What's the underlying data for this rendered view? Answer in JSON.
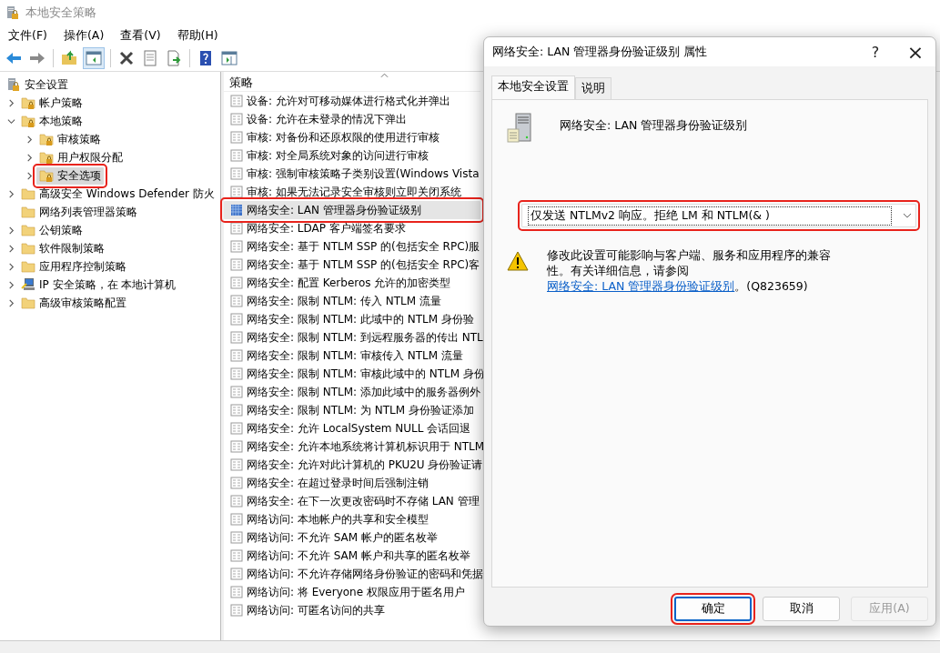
{
  "window": {
    "title": "本地安全策略"
  },
  "menu": [
    "文件(F)",
    "操作(A)",
    "查看(V)",
    "帮助(H)"
  ],
  "tree": [
    {
      "label": "安全设置",
      "kind": "root",
      "selected": false,
      "annotated": false,
      "children": [
        {
          "label": "帐户策略",
          "kind": "locked-folder",
          "expanded": false,
          "selected": false,
          "annotated": false
        },
        {
          "label": "本地策略",
          "kind": "locked-folder",
          "expanded": true,
          "selected": false,
          "annotated": false,
          "children": [
            {
              "label": "审核策略",
              "kind": "locked-folder",
              "expanded": false,
              "selected": false,
              "annotated": false
            },
            {
              "label": "用户权限分配",
              "kind": "locked-folder",
              "expanded": false,
              "selected": false,
              "annotated": false
            },
            {
              "label": "安全选项",
              "kind": "locked-folder",
              "expanded": false,
              "selected": true,
              "annotated": true
            }
          ]
        },
        {
          "label": "高级安全 Windows Defender 防火",
          "kind": "folder",
          "expanded": false,
          "selected": false,
          "annotated": false
        },
        {
          "label": "网络列表管理器策略",
          "kind": "folder",
          "selected": false,
          "annotated": false
        },
        {
          "label": "公钥策略",
          "kind": "folder",
          "expanded": false,
          "selected": false,
          "annotated": false
        },
        {
          "label": "软件限制策略",
          "kind": "folder",
          "expanded": false,
          "selected": false,
          "annotated": false
        },
        {
          "label": "应用程序控制策略",
          "kind": "folder",
          "expanded": false,
          "selected": false,
          "annotated": false
        },
        {
          "label": "IP 安全策略，在 本地计算机",
          "kind": "network-computer",
          "expanded": false,
          "selected": false,
          "annotated": false
        },
        {
          "label": "高级审核策略配置",
          "kind": "folder",
          "expanded": false,
          "selected": false,
          "annotated": false
        }
      ]
    }
  ],
  "table": {
    "columns": [
      "策略"
    ],
    "rows": [
      {
        "policy": "设备: 允许对可移动媒体进行格式化并弹出",
        "selected": false,
        "annotated": false
      },
      {
        "policy": "设备: 允许在未登录的情况下弹出",
        "selected": false,
        "annotated": false
      },
      {
        "policy": "审核: 对备份和还原权限的使用进行审核",
        "selected": false,
        "annotated": false
      },
      {
        "policy": "审核: 对全局系统对象的访问进行审核",
        "selected": false,
        "annotated": false
      },
      {
        "policy": "审核: 强制审核策略子类别设置(Windows Vista",
        "selected": false,
        "annotated": false
      },
      {
        "policy": "审核: 如果无法记录安全审核则立即关闭系统",
        "selected": false,
        "annotated": false
      },
      {
        "policy": "网络安全: LAN 管理器身份验证级别",
        "selected": true,
        "annotated": true
      },
      {
        "policy": "网络安全: LDAP 客户端签名要求",
        "selected": false,
        "annotated": false
      },
      {
        "policy": "网络安全: 基于 NTLM SSP 的(包括安全 RPC)服",
        "selected": false,
        "annotated": false
      },
      {
        "policy": "网络安全: 基于 NTLM SSP 的(包括安全 RPC)客",
        "selected": false,
        "annotated": false
      },
      {
        "policy": "网络安全: 配置 Kerberos 允许的加密类型",
        "selected": false,
        "annotated": false
      },
      {
        "policy": "网络安全: 限制 NTLM: 传入 NTLM 流量",
        "selected": false,
        "annotated": false
      },
      {
        "policy": "网络安全: 限制 NTLM: 此域中的 NTLM 身份验",
        "selected": false,
        "annotated": false
      },
      {
        "policy": "网络安全: 限制 NTLM: 到远程服务器的传出 NTL",
        "selected": false,
        "annotated": false
      },
      {
        "policy": "网络安全: 限制 NTLM: 审核传入 NTLM 流量",
        "selected": false,
        "annotated": false
      },
      {
        "policy": "网络安全: 限制 NTLM: 审核此域中的 NTLM 身份",
        "selected": false,
        "annotated": false
      },
      {
        "policy": "网络安全: 限制 NTLM: 添加此域中的服务器例外",
        "selected": false,
        "annotated": false
      },
      {
        "policy": "网络安全: 限制 NTLM: 为 NTLM 身份验证添加",
        "selected": false,
        "annotated": false
      },
      {
        "policy": "网络安全: 允许 LocalSystem NULL 会话回退",
        "selected": false,
        "annotated": false
      },
      {
        "policy": "网络安全: 允许本地系统将计算机标识用于 NTLM",
        "selected": false,
        "annotated": false
      },
      {
        "policy": "网络安全: 允许对此计算机的 PKU2U 身份验证请",
        "selected": false,
        "annotated": false
      },
      {
        "policy": "网络安全: 在超过登录时间后强制注销",
        "selected": false,
        "annotated": false
      },
      {
        "policy": "网络安全: 在下一次更改密码时不存储 LAN 管理",
        "selected": false,
        "annotated": false
      },
      {
        "policy": "网络访问: 本地帐户的共享和安全模型",
        "selected": false,
        "annotated": false
      },
      {
        "policy": "网络访问: 不允许 SAM 帐户的匿名枚举",
        "selected": false,
        "annotated": false
      },
      {
        "policy": "网络访问: 不允许 SAM 帐户和共享的匿名枚举",
        "selected": false,
        "annotated": false
      },
      {
        "policy": "网络访问: 不允许存储网络身份验证的密码和凭据",
        "selected": false,
        "annotated": false
      },
      {
        "policy": "网络访问: 将 Everyone 权限应用于匿名用户",
        "selected": false,
        "annotated": false
      },
      {
        "policy": "网络访问: 可匿名访问的共享",
        "selected": false,
        "annotated": false
      }
    ]
  },
  "dialog": {
    "title": "网络安全: LAN 管理器身份验证级别 属性",
    "help": "?",
    "close": "×",
    "tabs": [
      {
        "label": "本地安全设置",
        "selected": true
      },
      {
        "label": "说明",
        "selected": false
      }
    ],
    "policy_name": "网络安全: LAN 管理器身份验证级别",
    "setting": {
      "value": "仅发送 NTLMv2 响应。拒绝 LM 和 NTLM(& )",
      "annotated": true
    },
    "warning": {
      "text": "修改此设置可能影响与客户端、服务和应用程序的兼容性。有关详细信息，请参阅",
      "link": "网络安全: LAN 管理器身份验证级别",
      "after": "。(Q823659)"
    },
    "buttons": [
      {
        "label": "确定",
        "disabled": false,
        "default": true,
        "annotated": true
      },
      {
        "label": "取消",
        "disabled": false,
        "default": false,
        "annotated": false
      },
      {
        "label": "应用(A)",
        "disabled": true,
        "default": false,
        "annotated": false
      }
    ]
  }
}
